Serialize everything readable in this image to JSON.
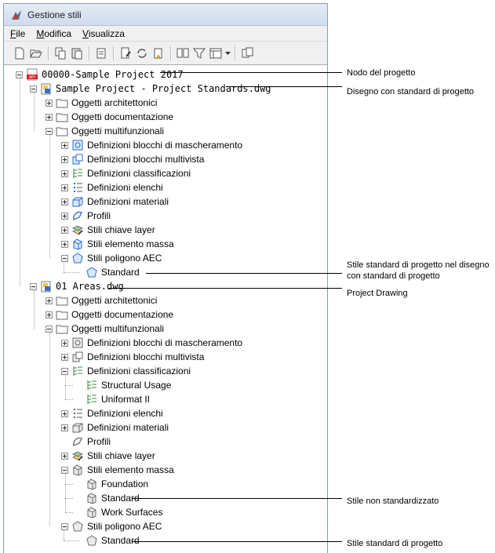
{
  "window": {
    "title": "Gestione stili"
  },
  "menu": [
    {
      "label": "File",
      "underline": "F",
      "rest": "ile"
    },
    {
      "label": "Modifica",
      "underline": "M",
      "rest": "odifica"
    },
    {
      "label": "Visualizza",
      "underline": "V",
      "rest": "isualizza"
    }
  ],
  "toolbar": {
    "buttons": [
      "new-icon",
      "open-icon",
      "copy-icon",
      "paste-icon",
      "purge-icon",
      "edit-icon",
      "synchronize-icon",
      "lock-icon",
      "compare-icon",
      "filter-icon",
      "view-icon",
      "dropdown-icon",
      "settings-icon"
    ]
  },
  "tree": [
    {
      "id": "project",
      "label": "00000-Sample Project 2017",
      "icon": "project-icon",
      "exp": "minus",
      "mono": true
    },
    {
      "id": "standards-dwg",
      "label": "Sample Project - Project Standards.dwg",
      "icon": "drawing-icon",
      "exp": "minus",
      "mono": true
    },
    {
      "id": "s-arch",
      "label": "Oggetti architettonici",
      "icon": "folder-icon",
      "exp": "plus"
    },
    {
      "id": "s-doc",
      "label": "Oggetti documentazione",
      "icon": "folder-icon",
      "exp": "plus"
    },
    {
      "id": "s-multi",
      "label": "Oggetti multifunzionali",
      "icon": "folder-icon",
      "exp": "minus"
    },
    {
      "id": "s-mask",
      "label": "Definizioni blocchi di mascheramento",
      "icon": "mask-block-icon",
      "exp": "plus"
    },
    {
      "id": "s-mv",
      "label": "Definizioni blocchi multivista",
      "icon": "multiview-block-icon",
      "exp": "plus"
    },
    {
      "id": "s-class",
      "label": "Definizioni classificazioni",
      "icon": "classification-icon",
      "exp": "plus"
    },
    {
      "id": "s-list",
      "label": "Definizioni elenchi",
      "icon": "list-icon",
      "exp": "plus"
    },
    {
      "id": "s-mat",
      "label": "Definizioni materiali",
      "icon": "material-icon",
      "exp": "plus"
    },
    {
      "id": "s-prof",
      "label": "Profili",
      "icon": "profile-icon",
      "exp": "plus"
    },
    {
      "id": "s-layer",
      "label": "Stili chiave layer",
      "icon": "layer-key-icon",
      "exp": "plus"
    },
    {
      "id": "s-mass",
      "label": "Stili elemento massa",
      "icon": "mass-element-icon",
      "exp": "plus"
    },
    {
      "id": "s-poly",
      "label": "Stili poligono AEC",
      "icon": "polygon-icon",
      "exp": "minus"
    },
    {
      "id": "s-std",
      "label": "Standard",
      "icon": "polygon-icon",
      "exp": "none"
    },
    {
      "id": "areas-dwg",
      "label": "01 Areas.dwg",
      "icon": "drawing-icon",
      "exp": "minus",
      "mono": true
    },
    {
      "id": "a-arch",
      "label": "Oggetti architettonici",
      "icon": "folder-icon",
      "exp": "plus"
    },
    {
      "id": "a-doc",
      "label": "Oggetti documentazione",
      "icon": "folder-icon",
      "exp": "plus"
    },
    {
      "id": "a-multi",
      "label": "Oggetti multifunzionali",
      "icon": "folder-icon",
      "exp": "minus"
    },
    {
      "id": "a-mask",
      "label": "Definizioni blocchi di mascheramento",
      "icon": "mask-block-icon-gray",
      "exp": "plus"
    },
    {
      "id": "a-mv",
      "label": "Definizioni blocchi multivista",
      "icon": "multiview-block-icon-gray",
      "exp": "plus"
    },
    {
      "id": "a-class",
      "label": "Definizioni classificazioni",
      "icon": "classification-icon",
      "exp": "minus"
    },
    {
      "id": "a-su",
      "label": "Structural Usage",
      "icon": "classification-icon",
      "exp": "none"
    },
    {
      "id": "a-uf",
      "label": "Uniformat II",
      "icon": "classification-icon",
      "exp": "none"
    },
    {
      "id": "a-list",
      "label": "Definizioni elenchi",
      "icon": "list-icon-gray",
      "exp": "plus"
    },
    {
      "id": "a-mat",
      "label": "Definizioni materiali",
      "icon": "material-icon-gray",
      "exp": "plus"
    },
    {
      "id": "a-prof",
      "label": "Profili",
      "icon": "profile-icon-gray",
      "exp": "none"
    },
    {
      "id": "a-layer",
      "label": "Stili chiave layer",
      "icon": "layer-key-icon",
      "exp": "plus"
    },
    {
      "id": "a-mass",
      "label": "Stili elemento massa",
      "icon": "mass-element-icon-gray",
      "exp": "minus"
    },
    {
      "id": "a-found",
      "label": "Foundation",
      "icon": "mass-element-icon-gray",
      "exp": "none"
    },
    {
      "id": "a-std",
      "label": "Standard",
      "icon": "mass-element-icon-gray",
      "exp": "none"
    },
    {
      "id": "a-ws",
      "label": "Work Surfaces",
      "icon": "mass-element-icon-gray",
      "exp": "none"
    },
    {
      "id": "a-poly",
      "label": "Stili poligono AEC",
      "icon": "polygon-icon-gray",
      "exp": "minus"
    },
    {
      "id": "a-pstd",
      "label": "Standard",
      "icon": "polygon-icon-gray",
      "exp": "none"
    }
  ],
  "callouts": [
    {
      "id": "nodo",
      "text": "Nodo del progetto"
    },
    {
      "id": "disegno",
      "text": "Disegno con standard di progetto"
    },
    {
      "id": "stile-std",
      "text": "Stile standard di progetto nel disegno con standard di progetto"
    },
    {
      "id": "project-drawing",
      "text": "Project Drawing"
    },
    {
      "id": "non-std",
      "text": "Stile non standardizzato"
    },
    {
      "id": "stile-progetto",
      "text": "Stile standard di progetto"
    }
  ]
}
